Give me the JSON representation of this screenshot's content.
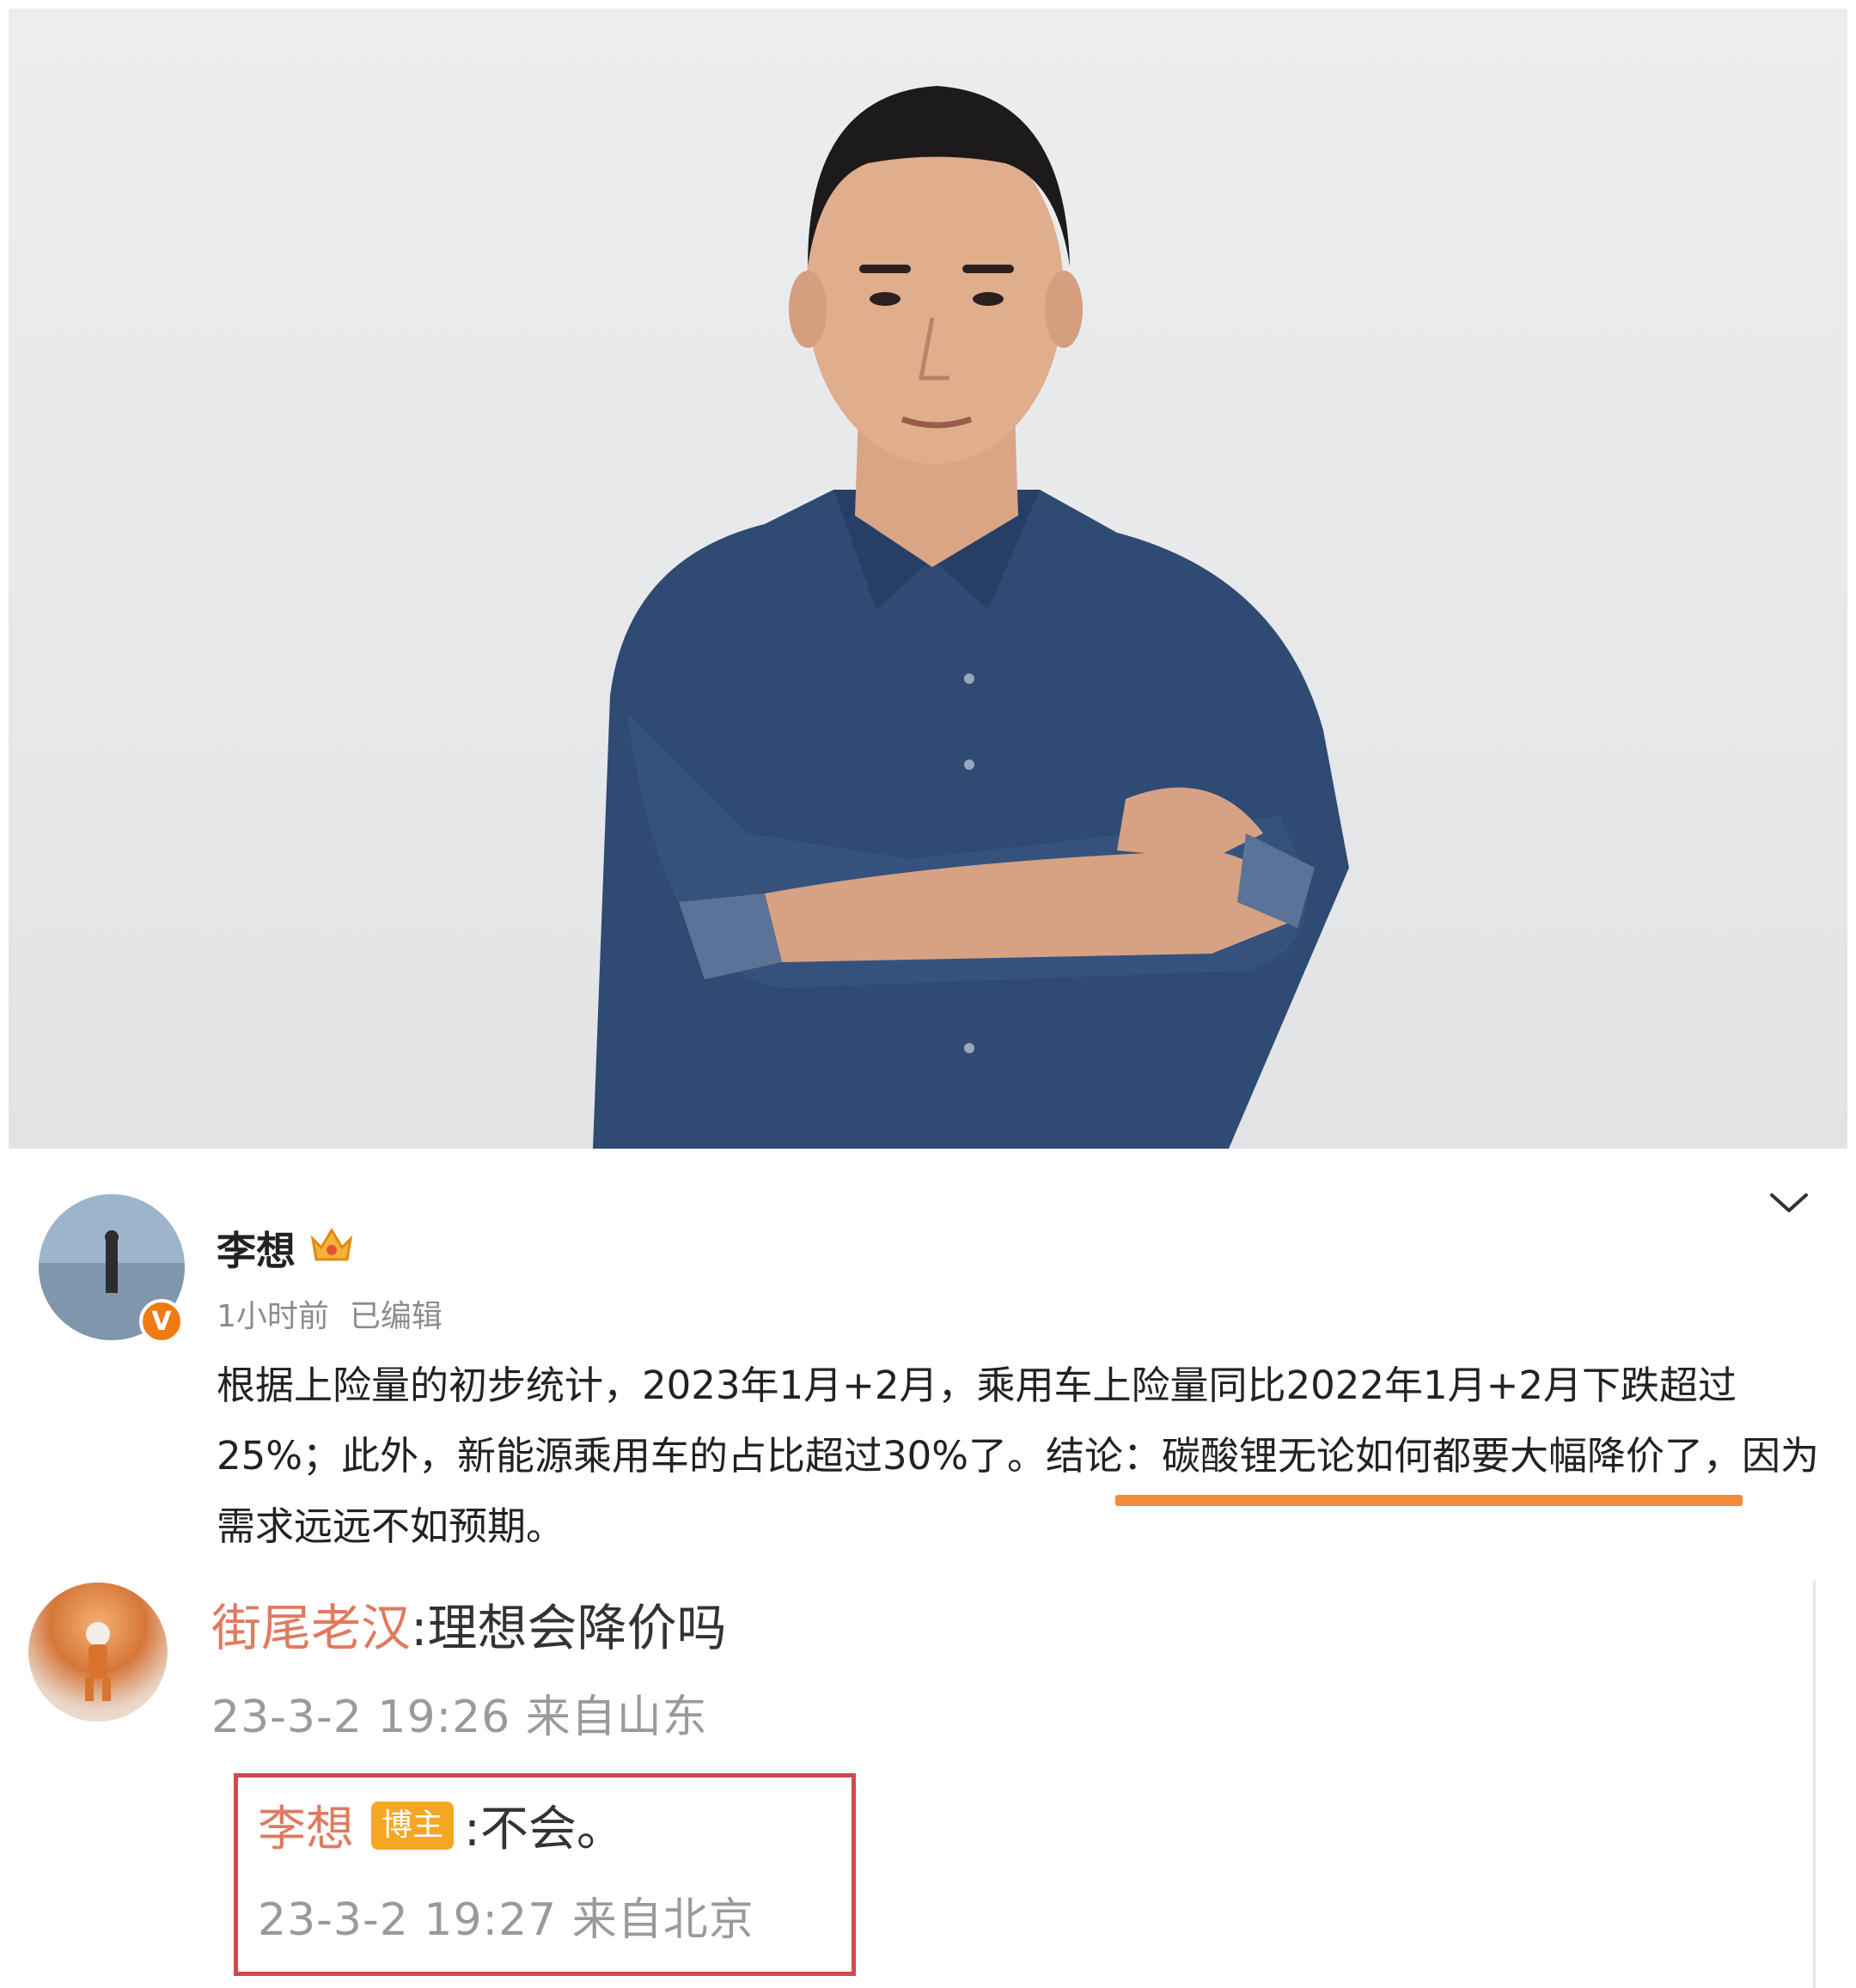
{
  "post": {
    "author": "李想",
    "time": "1小时前",
    "edited": "已编辑",
    "verified_badge": "V",
    "text": "根据上险量的初步统计，2023年1月+2月，乘用车上险量同比2022年1月+2月下跌超过25%；此外，新能源乘用车的占比超过30%了。结论：碳酸锂无论如何都要大幅降价了，因为需求远远不如预期。"
  },
  "comment": {
    "user": "街尾老汉",
    "text": ":理想会降价吗",
    "meta": "23-3-2 19:26 来自山东"
  },
  "reply": {
    "user": "李想",
    "badge": "博主",
    "text": ":不会。",
    "meta": "23-3-2 19:27 来自北京"
  },
  "colors": {
    "highlight_underline": "#f58a38",
    "reply_border": "#cf4b4b",
    "username": "#e07a5f"
  }
}
